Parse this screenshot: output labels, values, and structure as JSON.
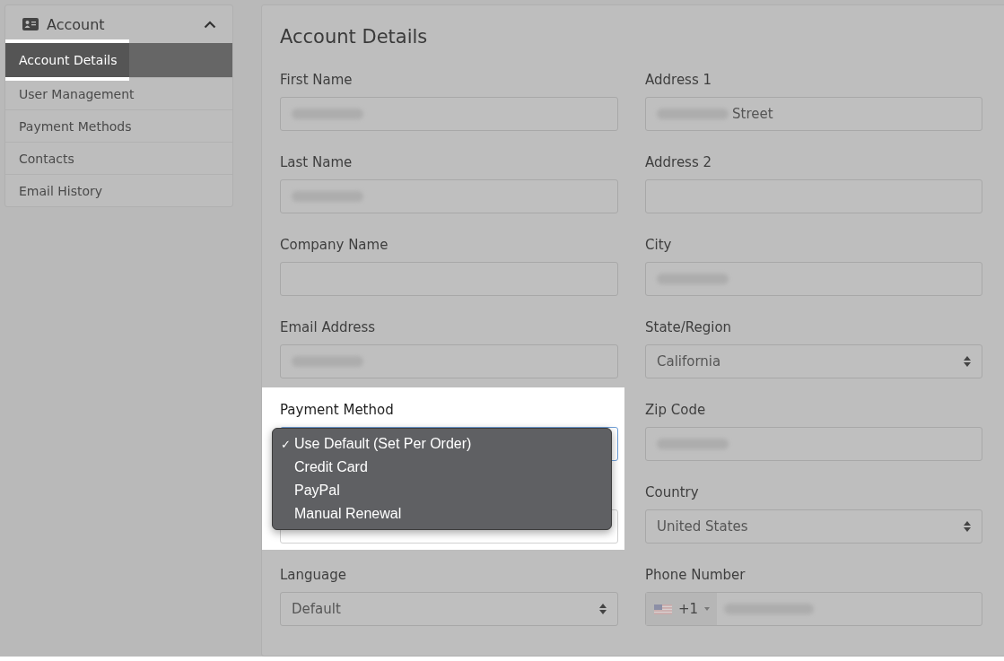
{
  "sidebar": {
    "title": "Account",
    "expanded": true,
    "items": [
      {
        "label": "Account Details",
        "selected": true
      },
      {
        "label": "User Management",
        "selected": false
      },
      {
        "label": "Payment Methods",
        "selected": false
      },
      {
        "label": "Contacts",
        "selected": false
      },
      {
        "label": "Email History",
        "selected": false
      }
    ]
  },
  "form": {
    "title": "Account Details",
    "fields": [
      {
        "kind": "redacted",
        "label": "First Name"
      },
      {
        "kind": "redacted",
        "label": "Address 1",
        "value": "Street"
      },
      {
        "kind": "redacted",
        "label": "Last Name"
      },
      {
        "kind": "text",
        "label": "Address 2"
      },
      {
        "kind": "text",
        "label": "Company Name"
      },
      {
        "kind": "redacted",
        "label": "City"
      },
      {
        "kind": "redacted",
        "label": "Email Address"
      },
      {
        "kind": "select",
        "label": "State/Region",
        "value": "California"
      },
      {
        "kind": "menu",
        "label": "Payment Method",
        "options": [
          {
            "check": "✓",
            "label": "Use Default (Set Per Order)"
          },
          {
            "label": "Credit Card"
          },
          {
            "label": "PayPal"
          },
          {
            "label": "Manual Renewal"
          }
        ]
      },
      {
        "kind": "redacted",
        "label": "Zip Code"
      },
      {
        "kind": "select",
        "label": "Country",
        "value": "United States"
      },
      {
        "kind": "select",
        "label": "Language",
        "value": "Default"
      },
      {
        "kind": "phone",
        "label": "Phone Number",
        "code": "+1"
      }
    ]
  }
}
